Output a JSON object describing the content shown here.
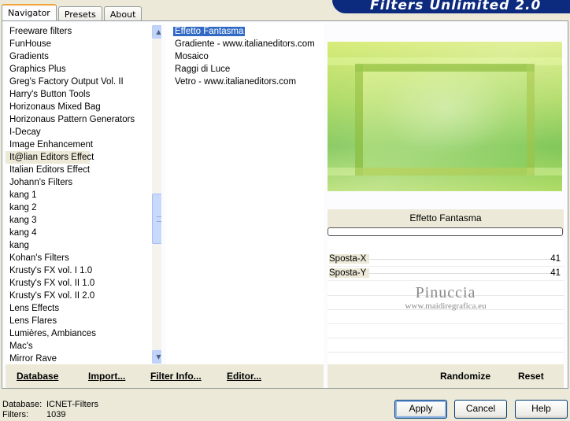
{
  "window": {
    "banner_title": "Filters Unlimited 2.0"
  },
  "tabs": [
    {
      "label": "Navigator"
    },
    {
      "label": "Presets"
    },
    {
      "label": "About"
    }
  ],
  "categories": {
    "items": [
      "Freeware filters",
      "FunHouse",
      "Gradients",
      "Graphics Plus",
      "Greg's Factory Output Vol. II",
      "Harry's Button Tools",
      "Horizonaus Mixed Bag",
      "Horizonaus Pattern Generators",
      "I-Decay",
      "Image Enhancement",
      "It@lian Editors Effect",
      "Italian Editors Effect",
      "Johann's Filters",
      "kang 1",
      "kang 2",
      "kang 3",
      "kang 4",
      "kang",
      "Kohan's Filters",
      "Krusty's FX vol. I 1.0",
      "Krusty's FX vol. II 1.0",
      "Krusty's FX vol. II 2.0",
      "Lens Effects",
      "Lens Flares",
      "Lumières, Ambiances",
      "Mac's",
      "Mirror Rave"
    ],
    "selected": "It@lian Editors Effect"
  },
  "filters": {
    "items": [
      "Effetto Fantasma",
      "Gradiente - www.italianeditors.com",
      "Mosaico",
      "Raggi di Luce",
      "Vetro - www.italianeditors.com"
    ],
    "selected": "Effetto Fantasma"
  },
  "left_buttons": {
    "database": "Database",
    "import": "Import...",
    "filter_info": "Filter Info...",
    "editor": "Editor..."
  },
  "preview": {
    "filter_name": "Effetto Fantasma"
  },
  "params": [
    {
      "label": "Sposta-X",
      "value": "41"
    },
    {
      "label": "Sposta-Y",
      "value": "41"
    }
  ],
  "watermark": {
    "line1": "Pinuccia",
    "line2": "www.maidiregrafica.eu"
  },
  "right_buttons": {
    "randomize": "Randomize",
    "reset": "Reset"
  },
  "status": {
    "database_label": "Database:",
    "database_value": "ICNET-Filters",
    "filters_label": "Filters:",
    "filters_value": "1039"
  },
  "dialog_buttons": {
    "apply": "Apply",
    "cancel": "Cancel",
    "help": "Help"
  }
}
